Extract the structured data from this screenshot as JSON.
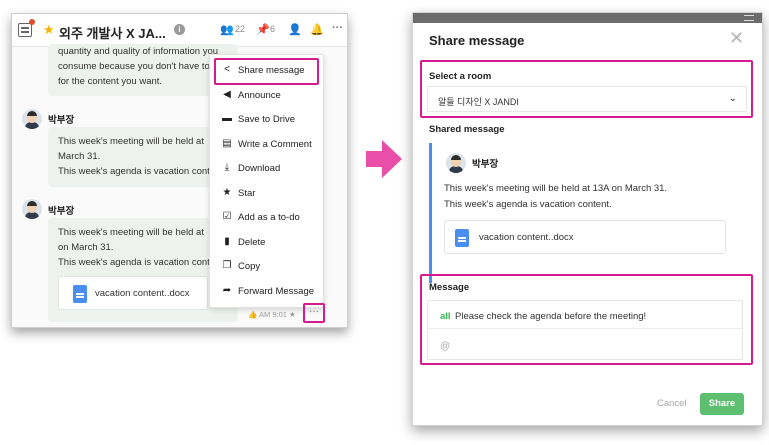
{
  "colors": {
    "highlight": "#d81b8c",
    "brand_green": "#5fbf70",
    "file_blue": "#4a8ff0",
    "arrow": "#e94ea8"
  },
  "left": {
    "room_title": "외주 개발사 X JA...",
    "members_count": "22",
    "pins_count": "6",
    "messages": [
      {
        "lines": [
          "quantity and quality of information you",
          "consume because you don't have to",
          "for the content you want."
        ]
      },
      {
        "sender": "박부장",
        "lines": [
          "This week's meeting will be held at",
          "March 31.",
          "This week's agenda is vacation content."
        ]
      },
      {
        "sender": "박부장",
        "lines": [
          "This week's meeting will be held at",
          "on March 31.",
          "This week's agenda is vacation content."
        ],
        "file": "vacation content..docx"
      }
    ],
    "time": "AM 9:01",
    "more_label": "···",
    "menu": [
      {
        "label": "Share message",
        "icon": "share-icon"
      },
      {
        "label": "Announce",
        "icon": "megaphone-icon"
      },
      {
        "label": "Save to Drive",
        "icon": "drive-icon"
      },
      {
        "label": "Write a Comment",
        "icon": "comment-icon"
      },
      {
        "label": "Download",
        "icon": "download-icon"
      },
      {
        "label": "Star",
        "icon": "star-icon"
      },
      {
        "label": "Add as a to-do",
        "icon": "todo-icon"
      },
      {
        "label": "Delete",
        "icon": "trash-icon"
      },
      {
        "label": "Copy",
        "icon": "copy-icon"
      },
      {
        "label": "Forward Message",
        "icon": "forward-icon"
      }
    ]
  },
  "right": {
    "title": "Share message",
    "select_room_label": "Select a room",
    "room_value": "알들 디자인 X JANDI",
    "shared_label": "Shared message",
    "sender": "박부장",
    "line1": "This week's meeting will be held at 13A on March 31.",
    "line2": "This week's agenda is vacation content.",
    "file": "vacation content..docx",
    "message_label": "Message",
    "mention": "all",
    "message_value": "Please check the agenda before the meeting!",
    "mention_placeholder": "@",
    "cancel": "Cancel",
    "share": "Share"
  }
}
